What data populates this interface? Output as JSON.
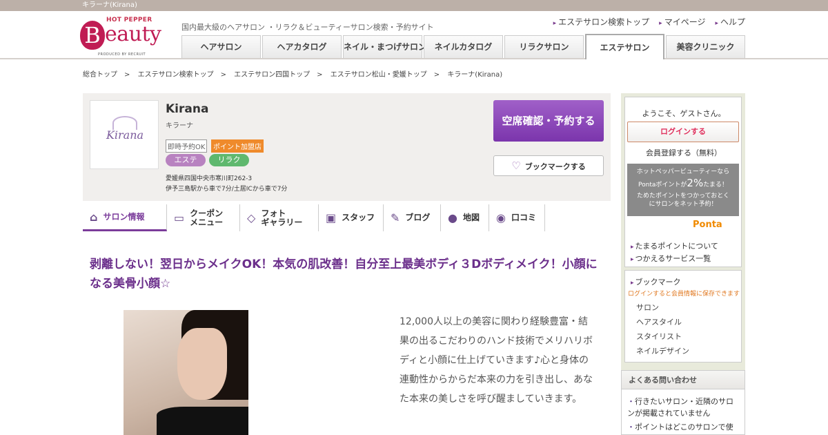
{
  "topbar": {
    "title": "キラーナ(Kirana)"
  },
  "header": {
    "logo_top": "HOT PEPPER",
    "logo_letter": "B",
    "logo_rest": "eauty",
    "logo_produced": "PRODUCED BY RECRUIT",
    "tagline": "国内最大級のヘアサロン ・リラク＆ビューティーサロン検索・予約サイト",
    "links": [
      "エステサロン検索トップ",
      "マイページ",
      "ヘルプ"
    ],
    "tabs": [
      "ヘアサロン",
      "ヘアカタログ",
      "ネイル・まつげサロン",
      "ネイルカタログ",
      "リラクサロン",
      "エステサロン",
      "美容クリニック"
    ],
    "active_tab": "エステサロン"
  },
  "breadcrumb": [
    "総合トップ",
    "エステサロン検索トップ",
    "エステサロン四国トップ",
    "エステサロン松山・愛媛トップ",
    "キラーナ(Kirana)"
  ],
  "breadcrumb_sep": ">",
  "salon": {
    "logo_text": "Kirana",
    "name": "Kirana",
    "kana": "キラーナ",
    "badge_instant": "即時予約OK",
    "badge_point": "ポイント加盟店",
    "categories": [
      "エステ",
      "リラク"
    ],
    "address": "愛媛県四国中央市寒川町262-3",
    "access": "伊予三島駅から車で7分/土居ICから車で7分",
    "reserve_label": "空席確認・予約する",
    "bookmark_label": "ブックマークする"
  },
  "subnav": [
    {
      "icon": "home-icon",
      "glyph": "⌂",
      "label": "サロン情報",
      "active": true
    },
    {
      "icon": "coupon-icon",
      "glyph": "▭",
      "label": "クーポン\nメニュー"
    },
    {
      "icon": "photo-icon",
      "glyph": "◇",
      "label": "フォト\nギャラリー"
    },
    {
      "icon": "staff-icon",
      "glyph": "▣",
      "label": "スタッフ"
    },
    {
      "icon": "pen-icon",
      "glyph": "✎",
      "label": "ブログ"
    },
    {
      "icon": "map-pin-icon",
      "glyph": "●",
      "label": "地図"
    },
    {
      "icon": "chat-icon",
      "glyph": "◉",
      "label": "口コミ"
    }
  ],
  "main": {
    "headline": "剥離しない！翌日からメイクOK！本気の肌改善！自分至上最美ボディ３Dボディメイク！小顔になる美骨小顔☆",
    "description": "12,000人以上の美容に関わり経験豊富・結果の出るこだわりのハンド技術でメリハリボディと小顔に仕上げていきます♪心と身体の連動性からからだ本来の力を引き出し、あなた本来の美しさを呼び醒ましていきます。"
  },
  "sidebar": {
    "welcome": "ようこそ、ゲストさん。",
    "login": "ログインする",
    "register": "会員登録する（無料）",
    "ponta_line1": "ホットペッパービューティーなら",
    "ponta_line2a": "Pontaポイントが",
    "ponta_pct": "2%",
    "ponta_line2b": "たまる！",
    "ponta_line3": "ためたポイントをつかっておとく",
    "ponta_line4": "にサロンをネット予約！",
    "ponta_logo": "Ponta",
    "ponta_links": [
      "たまるポイントについて",
      "つかえるサービス一覧"
    ],
    "bookmark_title": "ブックマーク",
    "bookmark_note": "ログインすると会員情報に保存できます",
    "bookmark_items": [
      "サロン",
      "ヘアスタイル",
      "スタイリスト",
      "ネイルデザイン"
    ],
    "faq_title": "よくある問い合わせ",
    "faq_items": [
      "行きたいサロン・近隣のサロンが掲載されていません",
      "ポイントはどこのサロンで使"
    ]
  }
}
